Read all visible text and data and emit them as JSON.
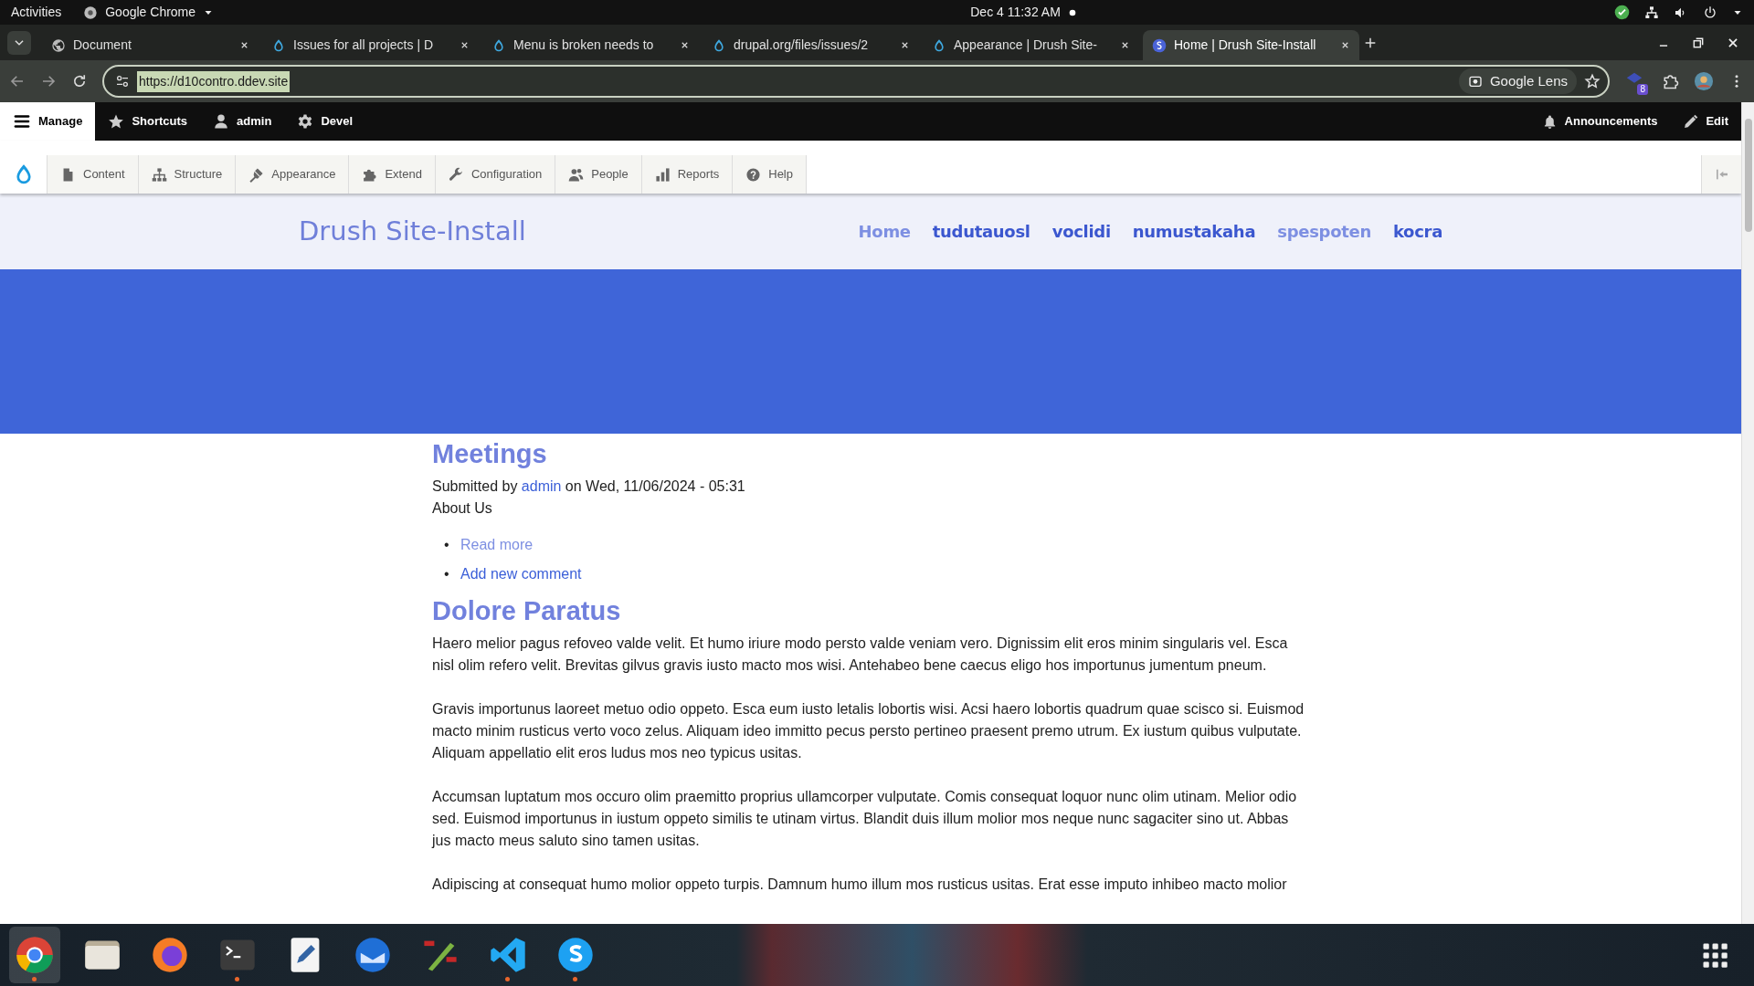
{
  "system_bar": {
    "activities": "Activities",
    "app": "Google Chrome",
    "clock": "Dec 4  11:32 AM"
  },
  "browser": {
    "tabs": [
      {
        "title": "Document",
        "selected": false
      },
      {
        "title": "Issues for all projects | D",
        "selected": false
      },
      {
        "title": "Menu is broken needs to",
        "selected": false
      },
      {
        "title": "drupal.org/files/issues/2",
        "selected": false
      },
      {
        "title": "Appearance | Drush Site-",
        "selected": false
      },
      {
        "title": "Home | Drush Site-Install",
        "selected": true
      }
    ],
    "url": "https://d10contro.ddev.site",
    "url_selected": true,
    "lens": "Google Lens",
    "extension_badge": "8"
  },
  "admin_toolbar": {
    "items": [
      {
        "label": "Manage",
        "selected": true
      },
      {
        "label": "Shortcuts",
        "selected": false
      },
      {
        "label": "admin",
        "selected": false
      },
      {
        "label": "Devel",
        "selected": false
      }
    ],
    "right_items": [
      {
        "label": "Announcements"
      },
      {
        "label": "Edit"
      }
    ]
  },
  "admin_tray": {
    "items": [
      {
        "label": "Content"
      },
      {
        "label": "Structure"
      },
      {
        "label": "Appearance"
      },
      {
        "label": "Extend"
      },
      {
        "label": "Configuration"
      },
      {
        "label": "People"
      },
      {
        "label": "Reports"
      },
      {
        "label": "Help"
      }
    ]
  },
  "site": {
    "name": "Drush Site-Install",
    "nav": [
      {
        "label": "Home",
        "visited": true
      },
      {
        "label": "tudutauosl",
        "visited": false
      },
      {
        "label": "voclidi",
        "visited": false
      },
      {
        "label": "numustakaha",
        "visited": false
      },
      {
        "label": "spespoten",
        "visited": true
      },
      {
        "label": "kocra",
        "visited": false
      }
    ]
  },
  "articles": [
    {
      "kind": "teaser",
      "title": "Meetings",
      "submitted": {
        "prefix": "Submitted by",
        "author": "admin",
        "date": "on Wed, 11/06/2024 - 05:31"
      },
      "body": "About Us",
      "links": [
        {
          "marker": "•",
          "label": "Read more",
          "visited": true
        },
        {
          "marker": "•",
          "label": "Add new comment",
          "visited": false
        }
      ]
    },
    {
      "kind": "full",
      "title": "Dolore Paratus",
      "paragraphs": [
        "Haero melior pagus refoveo valde velit. Et humo iriure modo persto valde veniam vero. Dignissim elit eros minim singularis vel. Esca nisl olim refero velit. Brevitas gilvus gravis iusto macto mos wisi. Antehabeo bene caecus eligo hos importunus jumentum pneum.",
        "Gravis importunus laoreet metuo odio oppeto. Esca eum iusto letalis lobortis wisi. Acsi haero lobortis quadrum quae scisco si. Euismod macto minim rusticus verto voco zelus. Aliquam ideo immitto pecus persto pertineo praesent premo utrum. Ex iustum quibus vulputate. Aliquam appellatio elit eros ludus mos neo typicus usitas.",
        "Accumsan luptatum mos occuro olim praemitto proprius ullamcorper vulputate. Comis consequat loquor nunc olim utinam. Melior odio sed. Euismod importunus in iustum oppeto similis te utinam virtus. Blandit duis illum molior mos neque nunc sagaciter sino ut. Abbas jus macto meus saluto sino tamen usitas.",
        "Adipiscing at consequat humo molior oppeto turpis. Damnum humo illum mos rusticus usitas. Erat esse imputo inhibeo macto molior"
      ]
    }
  ],
  "taskbar": {
    "apps": [
      {
        "running": true,
        "focused": true
      },
      {
        "running": false,
        "focused": false
      },
      {
        "running": false,
        "focused": false
      },
      {
        "running": true,
        "focused": false
      },
      {
        "running": false,
        "focused": false
      },
      {
        "running": false,
        "focused": false
      },
      {
        "running": false,
        "focused": false
      },
      {
        "running": true,
        "focused": false
      },
      {
        "running": true,
        "focused": false
      }
    ]
  }
}
